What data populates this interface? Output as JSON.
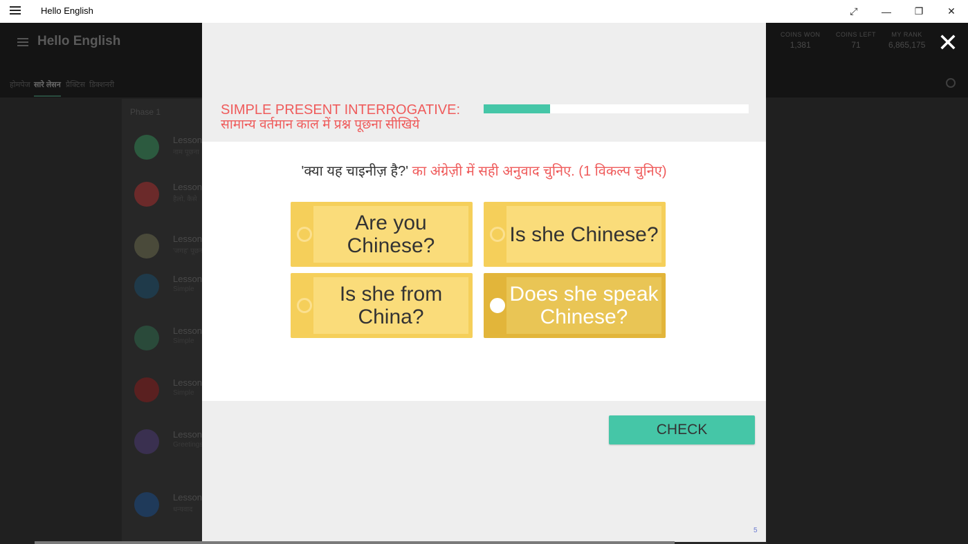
{
  "window": {
    "title": "Hello English",
    "controls": [
      "⤢",
      "—",
      "❐",
      "✕"
    ]
  },
  "app": {
    "brand": "Hello English",
    "stats": [
      {
        "label": "COINS WON",
        "value": "1,381"
      },
      {
        "label": "COINS LEFT",
        "value": "71"
      },
      {
        "label": "MY RANK",
        "value": "6,865,175"
      }
    ],
    "tabs": [
      "होमपेज",
      "सारे लेसन",
      "प्रैक्टिस",
      "डिक्शनरी"
    ],
    "phase": "Phase 1",
    "lessons": [
      {
        "title": "Lesson",
        "sub": "नाम पूछना",
        "color": "#2c5a3f"
      },
      {
        "title": "Lesson",
        "sub": "हैलो, कैसे",
        "color": "#6b2a2a"
      },
      {
        "title": "Lesson",
        "sub": "'जगह' पूछना",
        "color": "#4a4a3a"
      },
      {
        "title": "Lesson",
        "sub": "Simple",
        "color": "#1f3a4a"
      },
      {
        "title": "Lesson",
        "sub": "Simple",
        "color": "#2a4a3a"
      },
      {
        "title": "Lesson",
        "sub": "Simple",
        "color": "#5a2020"
      },
      {
        "title": "Lesson",
        "sub": "Greetings",
        "color": "#3a3050"
      },
      {
        "title": "Lesson",
        "sub": "धन्यवाद",
        "color": "#1f3a5a"
      }
    ]
  },
  "modal": {
    "title_line1": "SIMPLE PRESENT INTERROGATIVE:",
    "title_line2": "सामान्य वर्तमान काल में प्रश्न पूछना सीखिये",
    "progress": 0.25,
    "question_text": "'क्या यह चाइनीज़ है?'",
    "instruction": " का अंग्रेज़ी में सही अनुवाद चुनिए. (1 विकल्प चुनिए)",
    "options": [
      {
        "label": "Are you Chinese?",
        "selected": false
      },
      {
        "label": "Is she Chinese?",
        "selected": false
      },
      {
        "label": "Is she from China?",
        "selected": false
      },
      {
        "label": "Does she speak Chinese?",
        "selected": true
      }
    ],
    "check_label": "CHECK",
    "page_number": "5",
    "close_label": "✕"
  },
  "colors": {
    "accent_teal": "#45c6a7",
    "title_red": "#ef5b5b",
    "option_yellow": "#f5cf5a",
    "option_selected": "#e2b53a"
  }
}
